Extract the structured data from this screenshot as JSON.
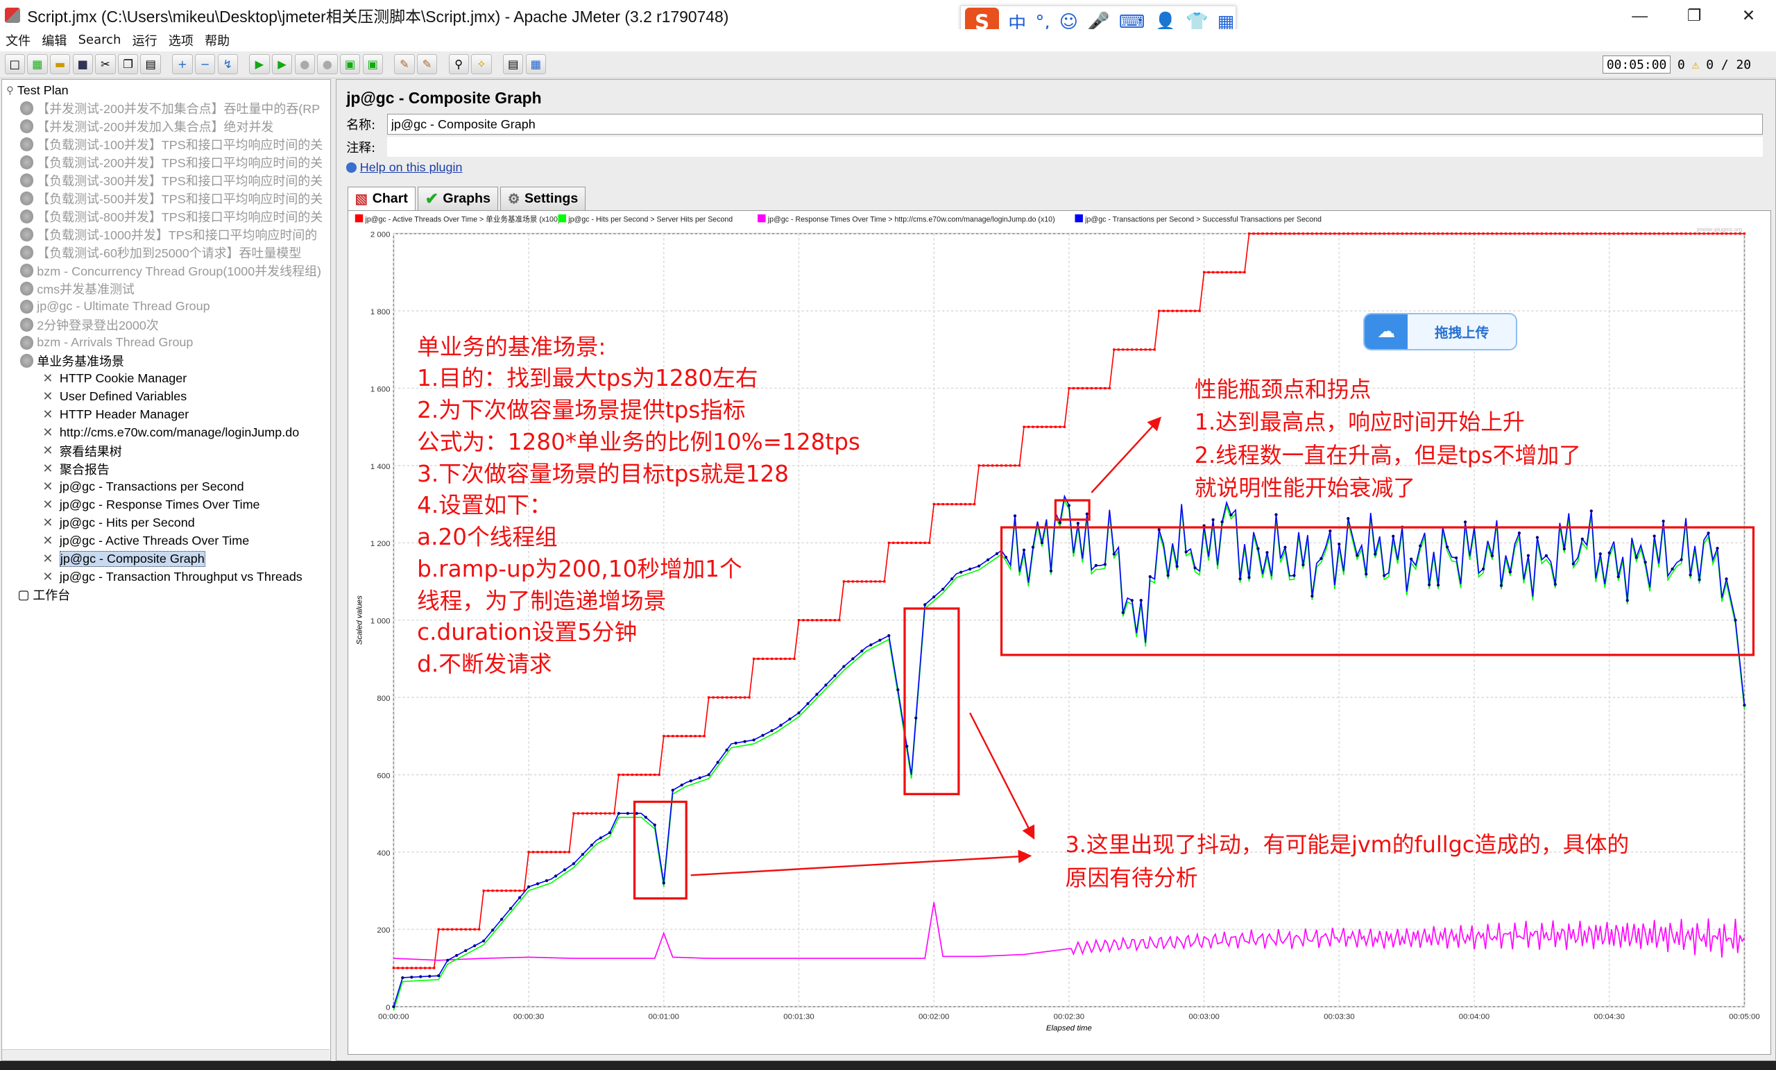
{
  "window": {
    "title": "Script.jmx (C:\\Users\\mikeu\\Desktop\\jmeter相关压测脚本\\Script.jmx) - Apache JMeter (3.2 r1790748)",
    "minimize": "—",
    "restore": "❐",
    "close": "✕"
  },
  "ime": {
    "logo": "S",
    "items": [
      "中",
      "°,",
      "☺",
      "🎤",
      "⌨",
      "👤",
      "👕",
      "▦"
    ]
  },
  "menu": [
    "文件",
    "编辑",
    "Search",
    "运行",
    "选项",
    "帮助"
  ],
  "toolbar": {
    "timer": "00:05:00",
    "warnings": "0",
    "threads": "0 / 20"
  },
  "tree": {
    "root": "Test Plan",
    "items": [
      {
        "label": "【并发测试-200并发不加集合点】吞吐量中的吞(RP",
        "dim": true,
        "level": 1
      },
      {
        "label": "【并发测试-200并发加入集合点】绝对并发",
        "dim": true,
        "level": 1
      },
      {
        "label": "【负载测试-100并发】TPS和接口平均响应时间的关",
        "dim": true,
        "level": 1
      },
      {
        "label": "【负载测试-200并发】TPS和接口平均响应时间的关",
        "dim": true,
        "level": 1
      },
      {
        "label": "【负载测试-300并发】TPS和接口平均响应时间的关",
        "dim": true,
        "level": 1
      },
      {
        "label": "【负载测试-500并发】TPS和接口平均响应时间的关",
        "dim": true,
        "level": 1
      },
      {
        "label": "【负载测试-800并发】TPS和接口平均响应时间的关",
        "dim": true,
        "level": 1
      },
      {
        "label": "【负载测试-1000并发】TPS和接口平均响应时间的",
        "dim": true,
        "level": 1
      },
      {
        "label": "【负载测试-60秒加到25000个请求】吞吐量模型",
        "dim": true,
        "level": 1
      },
      {
        "label": "bzm - Concurrency Thread Group(1000并发线程组)",
        "dim": true,
        "level": 1
      },
      {
        "label": "cms并发基准测试",
        "dim": true,
        "level": 1
      },
      {
        "label": "jp@gc - Ultimate Thread Group",
        "dim": true,
        "level": 1
      },
      {
        "label": "2分钟登录登出2000次",
        "dim": true,
        "level": 1
      },
      {
        "label": "bzm - Arrivals Thread Group",
        "dim": true,
        "level": 1
      },
      {
        "label": "单业务基准场景",
        "dim": false,
        "level": 1
      },
      {
        "label": "HTTP Cookie Manager",
        "dim": false,
        "level": 2
      },
      {
        "label": "User Defined Variables",
        "dim": false,
        "level": 2
      },
      {
        "label": "HTTP Header Manager",
        "dim": false,
        "level": 2
      },
      {
        "label": "http://cms.e70w.com/manage/loginJump.do",
        "dim": false,
        "level": 2
      },
      {
        "label": "察看结果树",
        "dim": false,
        "level": 2
      },
      {
        "label": "聚合报告",
        "dim": false,
        "level": 2
      },
      {
        "label": "jp@gc - Transactions per Second",
        "dim": false,
        "level": 2
      },
      {
        "label": "jp@gc - Response Times Over Time",
        "dim": false,
        "level": 2
      },
      {
        "label": "jp@gc - Hits per Second",
        "dim": false,
        "level": 2
      },
      {
        "label": "jp@gc - Active Threads Over Time",
        "dim": false,
        "level": 2
      },
      {
        "label": "jp@gc - Composite Graph",
        "dim": false,
        "level": 2,
        "selected": true
      },
      {
        "label": "jp@gc - Transaction Throughput vs Threads",
        "dim": false,
        "level": 2
      }
    ],
    "workbench": "工作台"
  },
  "panel": {
    "title": "jp@gc - Composite Graph",
    "name_label": "名称:",
    "name_value": "jp@gc - Composite Graph",
    "comment_label": "注释:",
    "help": "Help on this plugin",
    "tabs": [
      "Chart",
      "Graphs",
      "Settings"
    ],
    "watermark": "jmeter-plugins.org"
  },
  "upload_button": "拖拽上传",
  "annotations": {
    "left_block": [
      "单业务的基准场景:",
      "1.目的：找到最大tps为1280左右",
      "2.为下次做容量场景提供tps指标",
      "公式为：1280*单业务的比例10%=128tps",
      "3.下次做容量场景的目标tps就是128",
      "4.设置如下：",
      "a.20个线程组",
      "b.ramp-up为200,10秒增加1个",
      "线程，为了制造递增场景",
      "c.duration设置5分钟",
      "d.不断发请求"
    ],
    "right_block": [
      "性能瓶颈点和拐点",
      "1.达到最高点，响应时间开始上升",
      "2.线程数一直在升高，但是tps不增加了",
      "就说明性能开始衰减了"
    ],
    "bottom_block": [
      "3.这里出现了抖动，有可能是jvm的fullgc造成的，具体的",
      "原因有待分析"
    ]
  },
  "colors": {
    "active_threads": "#ff0000",
    "hits": "#00ff00",
    "response": "#ff00ff",
    "tps": "#0000ff",
    "annotation": "#f01010"
  },
  "chart_data": {
    "type": "line",
    "xlabel": "Elapsed time",
    "ylabel": "Scaled values",
    "ylim": [
      0,
      2000
    ],
    "xlim_seconds": [
      0,
      300
    ],
    "x_ticks": [
      "00:00:00",
      "00:00:30",
      "00:01:00",
      "00:01:30",
      "00:02:00",
      "00:02:30",
      "00:03:00",
      "00:03:30",
      "00:04:00",
      "00:04:30",
      "00:05:00"
    ],
    "y_ticks": [
      "0",
      "200",
      "400",
      "600",
      "800",
      "1 000",
      "1 200",
      "1 400",
      "1 600",
      "1 800",
      "2 000"
    ],
    "legend": [
      "jp@gc - Active Threads Over Time > 单业务基准场景 (x100)",
      "jp@gc - Hits per Second > Server Hits per Second",
      "jp@gc - Response Times Over Time > http://cms.e70w.com/manage/loginJump.do (x10)",
      "jp@gc - Transactions per Second > Successful Transactions per Second"
    ],
    "series": [
      {
        "name": "jp@gc - Active Threads Over Time > 单业务基准场景 (x100)",
        "color": "#ff0000",
        "step_every_s": 10,
        "step_value": 100,
        "start": 100,
        "max": 2000
      },
      {
        "name": "jp@gc - Transactions per Second > Successful Transactions per Second",
        "color": "#0000ff",
        "x": [
          0,
          2,
          10,
          12,
          20,
          25,
          30,
          35,
          40,
          45,
          48,
          50,
          55,
          58,
          60,
          62,
          65,
          70,
          75,
          80,
          85,
          90,
          95,
          100,
          105,
          110,
          112,
          115,
          118,
          120,
          122,
          125,
          130,
          135,
          140,
          145,
          150,
          155,
          160,
          165,
          170,
          175,
          180,
          185,
          190,
          195,
          200,
          205,
          210,
          215,
          220,
          225,
          230,
          235,
          240,
          245,
          250,
          255,
          260,
          265,
          270,
          275,
          280,
          285,
          290,
          295,
          298,
          300
        ],
        "y": [
          0,
          75,
          80,
          120,
          170,
          240,
          310,
          330,
          370,
          430,
          450,
          500,
          500,
          470,
          320,
          560,
          580,
          600,
          680,
          690,
          720,
          760,
          820,
          880,
          930,
          960,
          820,
          600,
          1040,
          1060,
          1080,
          1120,
          1140,
          1180,
          1160,
          1220,
          1280,
          1150,
          1200,
          960,
          1170,
          1200,
          1160,
          1280,
          1150,
          1180,
          1160,
          1150,
          1180,
          1200,
          1170,
          1160,
          1160,
          1170,
          1180,
          1170,
          1160,
          1140,
          1200,
          1200,
          1140,
          1150,
          1170,
          1160,
          1180,
          1160,
          1000,
          780
        ]
      },
      {
        "name": "jp@gc - Hits per Second > Server Hits per Second",
        "color": "#00ff00",
        "follows": "tps"
      },
      {
        "name": "jp@gc - Response Times Over Time > http://cms.e70w.com/manage/loginJump.do (x10)",
        "color": "#ff00ff",
        "x": [
          0,
          10,
          20,
          30,
          40,
          50,
          58,
          60,
          62,
          70,
          80,
          90,
          100,
          110,
          118,
          120,
          122,
          130,
          140,
          150,
          160,
          170,
          180,
          190,
          200,
          210,
          220,
          230,
          240,
          250,
          260,
          270,
          280,
          290,
          300
        ],
        "y": [
          125,
          120,
          125,
          128,
          125,
          125,
          125,
          190,
          128,
          125,
          125,
          125,
          125,
          125,
          125,
          270,
          130,
          130,
          135,
          150,
          160,
          165,
          170,
          175,
          175,
          180,
          175,
          180,
          180,
          185,
          185,
          185,
          185,
          180,
          175
        ]
      }
    ]
  }
}
